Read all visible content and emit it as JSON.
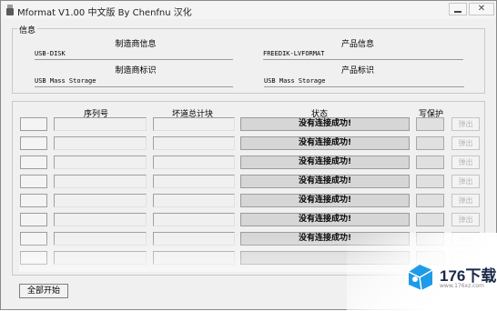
{
  "window": {
    "title": "Mformat V1.00 中文版 By Chenfnu 汉化",
    "close_glyph": "✕"
  },
  "info": {
    "group_label": "信息",
    "manufacturer_info_label": "制造商信息",
    "manufacturer_info_value": "USB-DISK",
    "product_info_label": "产品信息",
    "product_info_value": "FREEDIK-LVFORMAT",
    "manufacturer_id_label": "制造商标识",
    "manufacturer_id_value": "USB Mass Storage",
    "product_id_label": "产品标识",
    "product_id_value": "USB Mass Storage"
  },
  "table": {
    "headers": {
      "serial": "序列号",
      "bad_blocks": "坏道总计块",
      "status": "状态",
      "write_protect": "写保护"
    },
    "rows": [
      {
        "status": "没有连接成功!",
        "eject": "弹出"
      },
      {
        "status": "没有连接成功!",
        "eject": "弹出"
      },
      {
        "status": "没有连接成功!",
        "eject": "弹出"
      },
      {
        "status": "没有连接成功!",
        "eject": "弹出"
      },
      {
        "status": "没有连接成功!",
        "eject": "弹出"
      },
      {
        "status": "没有连接成功!",
        "eject": "弹出"
      },
      {
        "status": "没有连接成功!",
        "eject": "弹出"
      },
      {
        "status": "",
        "eject": ""
      }
    ]
  },
  "start_all_label": "全部开始",
  "watermark": {
    "brand": "176下载网",
    "url": "www.176xz.com",
    "accent": "#1e9be8"
  }
}
